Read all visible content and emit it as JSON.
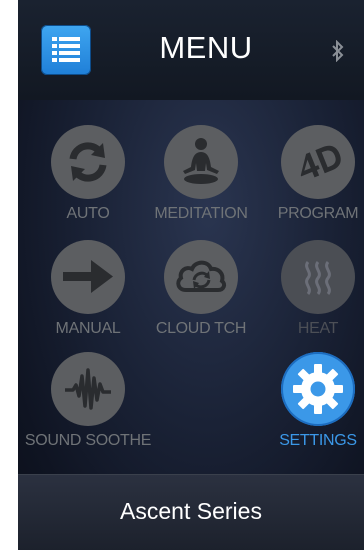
{
  "header": {
    "title": "MENU"
  },
  "tiles": [
    {
      "label": "AUTO",
      "icon": "refresh-arrows-icon",
      "active": false
    },
    {
      "label": "MEDITATION",
      "icon": "meditation-figure-icon",
      "active": false
    },
    {
      "label": "PROGRAM",
      "icon": "4d-icon",
      "active": false
    },
    {
      "label": "MANUAL",
      "icon": "right-arrow-icon",
      "active": false
    },
    {
      "label": "CLOUD TCH",
      "icon": "cloud-sync-icon",
      "active": false
    },
    {
      "label": "HEAT",
      "icon": "heat-waves-icon",
      "active": false
    },
    {
      "label": "SOUND SOOTHE",
      "icon": "sound-wave-icon",
      "active": false
    },
    {
      "label": "SETTINGS",
      "icon": "gear-icon",
      "active": true
    }
  ],
  "footer": {
    "title": "Ascent Series"
  },
  "colors": {
    "accent": "#3b98e8",
    "inactive": "#5c5e61",
    "label_inactive": "#6f7377"
  }
}
